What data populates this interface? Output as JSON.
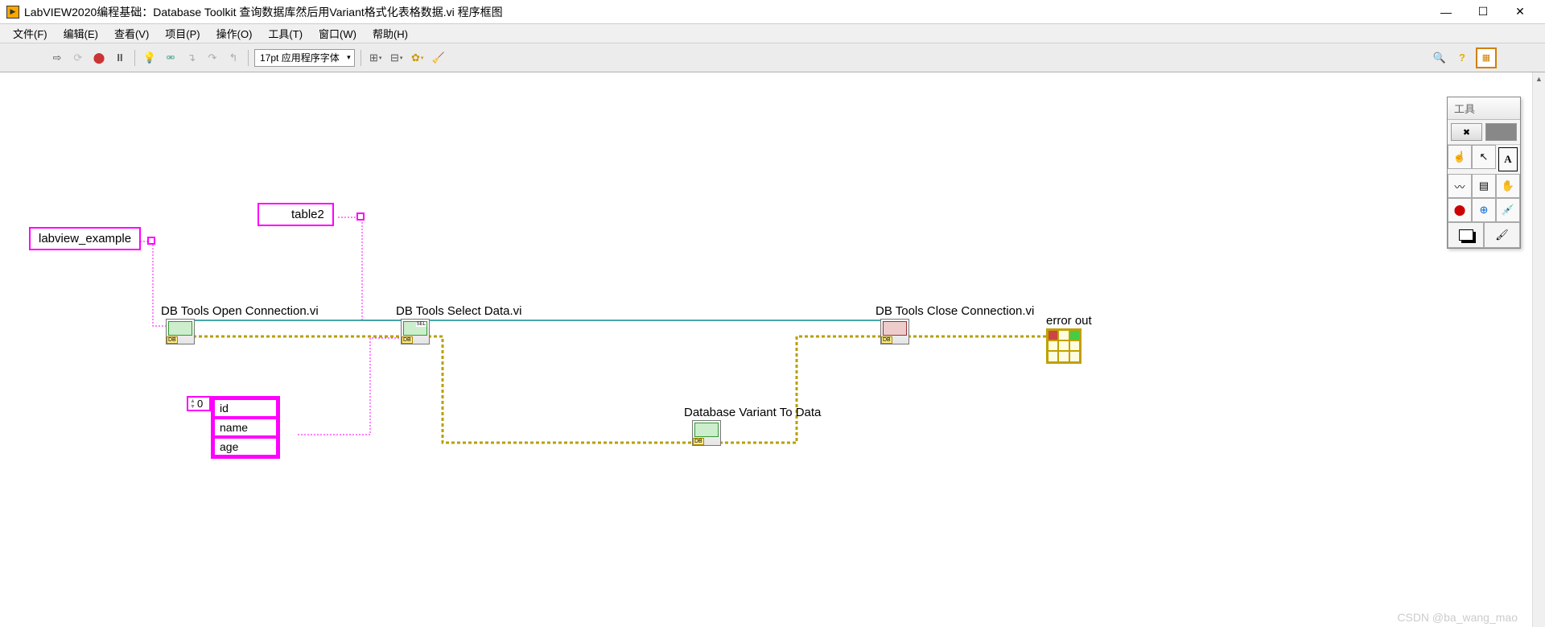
{
  "window": {
    "title": "LabVIEW2020编程基础：Database Toolkit 查询数据库然后用Variant格式化表格数据.vi 程序框图",
    "min": "—",
    "max": "☐",
    "close": "✕"
  },
  "menu": {
    "file": "文件(F)",
    "edit": "编辑(E)",
    "view": "查看(V)",
    "project": "项目(P)",
    "operate": "操作(O)",
    "tools": "工具(T)",
    "window": "窗口(W)",
    "help": "帮助(H)"
  },
  "toolbar": {
    "font_label": "17pt 应用程序字体"
  },
  "tools_palette": {
    "title": "工具"
  },
  "diagram": {
    "const_dsn": "labview_example",
    "const_table": "table2",
    "node_open": "DB Tools Open Connection.vi",
    "node_select": "DB Tools Select Data.vi",
    "node_var2data": "Database Variant To Data",
    "node_close": "DB Tools Close Connection.vi",
    "error_out_label": "error out",
    "array_index": "0",
    "array_items": {
      "0": "id",
      "1": "name",
      "2": "age"
    }
  },
  "watermark": "CSDN @ba_wang_mao"
}
